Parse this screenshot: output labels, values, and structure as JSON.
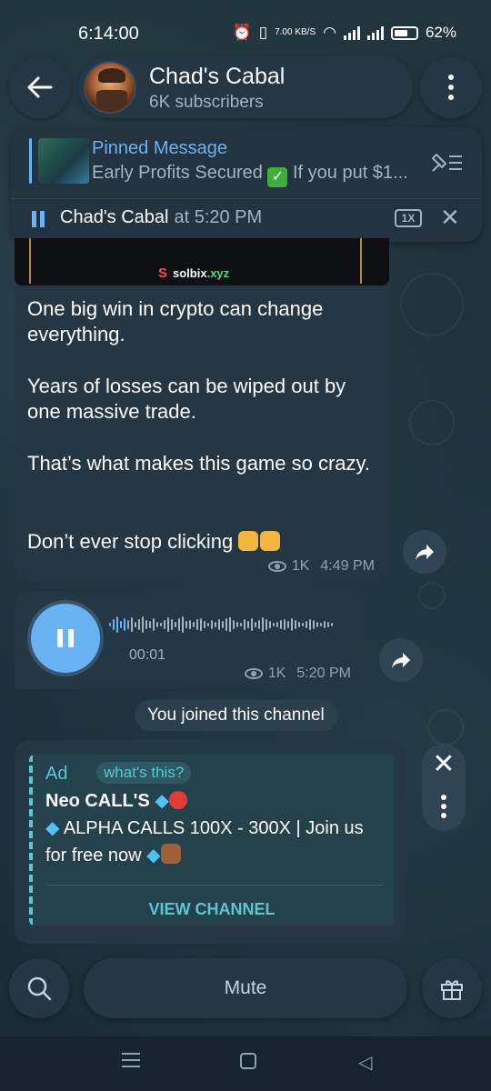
{
  "status_bar": {
    "time": "6:14:00",
    "net_speed": "7.00 KB/S",
    "battery": "62%"
  },
  "header": {
    "channel_name": "Chad's Cabal",
    "subscribers": "6K subscribers"
  },
  "pinned": {
    "title": "Pinned Message",
    "text_before": "Early Profits Secured",
    "text_after": " If you put $1...",
    "check": "✓"
  },
  "player": {
    "name": "Chad's Cabal",
    "time": "at 5:20 PM",
    "speed": "1X"
  },
  "image_message": {
    "brand": "solbix",
    "brand_tld": ".xyz",
    "brand_logo": "S"
  },
  "text_message": {
    "lines": [
      "One big win in crypto can change everything.",
      "Years of losses can be wiped out by one massive trade.",
      "That’s what makes this game so crazy.",
      "Don’t ever stop clicking"
    ],
    "views": "1K",
    "time": "4:49 PM"
  },
  "voice_message": {
    "elapsed": "00:01",
    "views": "1K",
    "time": "5:20 PM",
    "waveform": [
      4,
      12,
      18,
      8,
      14,
      10,
      16,
      6,
      12,
      18,
      10,
      8,
      14,
      6,
      4,
      10,
      16,
      12,
      6,
      14,
      18,
      8,
      10,
      6,
      12,
      14,
      8,
      4,
      10,
      6,
      12,
      8,
      14,
      16,
      10,
      6,
      4,
      12,
      8,
      14,
      6,
      10,
      16,
      12,
      8,
      4,
      6,
      10,
      12,
      8,
      14,
      10,
      6,
      4,
      8,
      12,
      10,
      6,
      4,
      8,
      6,
      4
    ]
  },
  "service": {
    "joined": "You joined this channel"
  },
  "ad": {
    "label": "Ad",
    "whats_this": "what's this?",
    "title": "Neo CALL'S",
    "body": "ALPHA CALLS 100X - 300X | Join us for free now",
    "cta": "VIEW CHANNEL"
  },
  "bottom": {
    "mute_label": "Mute"
  },
  "colors": {
    "accent": "#6ab3f3",
    "ad_accent": "#5bc6cf",
    "bubble": "#253744"
  },
  "icons": [
    "back-arrow-icon",
    "more-vertical-icon",
    "pin-list-icon",
    "pause-icon",
    "close-icon",
    "eye-icon",
    "share-icon",
    "search-icon",
    "gift-icon"
  ]
}
